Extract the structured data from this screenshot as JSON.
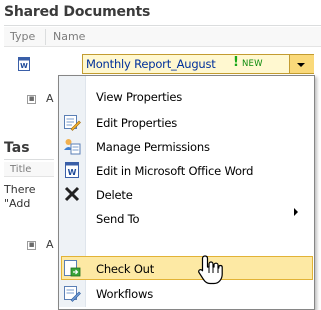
{
  "shared_documents": {
    "title": "Shared Documents",
    "columns": {
      "type": "Type",
      "name": "Name"
    },
    "document": {
      "name": "Monthly Report_August",
      "new_mark": "!",
      "new_badge": "NEW"
    },
    "add_link": "A"
  },
  "tasks": {
    "title": "Tas",
    "column": "Title",
    "empty_line1": "There",
    "empty_line2": "\"Add",
    "add_link": "A"
  },
  "context_menu": {
    "items": [
      {
        "label": "View Properties",
        "icon": "none"
      },
      {
        "label": "Edit Properties",
        "icon": "edit-properties-icon"
      },
      {
        "label": "Manage Permissions",
        "icon": "manage-permissions-icon"
      },
      {
        "label": "Edit in Microsoft Office Word",
        "icon": "word-document-icon"
      },
      {
        "label": "Delete",
        "icon": "delete-x-icon"
      },
      {
        "label": "Send To",
        "icon": "none",
        "has_submenu": true
      },
      {
        "label": "Check Out",
        "icon": "check-out-icon",
        "highlighted": true
      },
      {
        "label": "Workflows",
        "icon": "workflows-icon"
      }
    ]
  },
  "colors": {
    "link": "#00309b",
    "selected_row_bg": "#fff8d0",
    "highlight_bg": "#fde9a4",
    "highlight_border": "#e2b336",
    "new_badge": "#18a818"
  }
}
